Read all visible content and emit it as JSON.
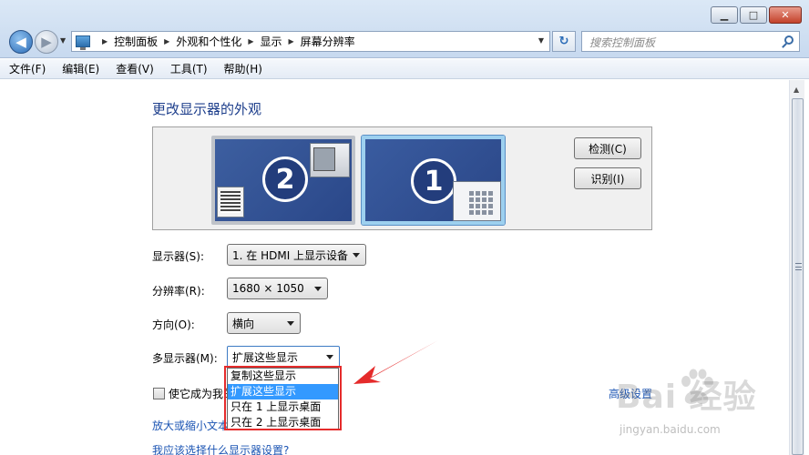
{
  "window": {
    "buttons": {
      "minimize": "▁",
      "maximize": "□",
      "close": "✕"
    }
  },
  "nav": {
    "back_icon": "◀",
    "forward_icon": "▶",
    "breadcrumbs": [
      "控制面板",
      "外观和个性化",
      "显示",
      "屏幕分辨率"
    ],
    "search_placeholder": "搜索控制面板",
    "refresh_icon": "↻"
  },
  "menu": [
    "文件(F)",
    "编辑(E)",
    "查看(V)",
    "工具(T)",
    "帮助(H)"
  ],
  "main": {
    "title": "更改显示器的外观",
    "monitors": [
      {
        "number": "2",
        "selected": false
      },
      {
        "number": "1",
        "selected": true
      }
    ],
    "detect_label": "检测(C)",
    "identify_label": "识别(I)",
    "display_label": "显示器(S):",
    "display_value": "1. 在 HDMI 上显示设备",
    "resolution_label": "分辨率(R):",
    "resolution_value": "1680 × 1050",
    "orientation_label": "方向(O):",
    "orientation_value": "横向",
    "multi_label": "多显示器(M):",
    "multi_value": "扩展这些显示",
    "multi_options": [
      "复制这些显示",
      "扩展这些显示",
      "只在 1 上显示桌面",
      "只在 2 上显示桌面"
    ],
    "multi_selected_index": 1,
    "primary_checkbox_label": "使它成为我的",
    "advanced_link": "高级设置",
    "zoom_link": "放大或缩小文本",
    "what_link": "我应该选择什么显示器设置?"
  },
  "watermark": {
    "logo": "Bai 经验",
    "url": "jingyan.baidu.com"
  },
  "colors": {
    "accent": "#1e3f8c",
    "link": "#1b54b3",
    "highlight": "#3399ff",
    "annotation_red": "#e52b2b"
  }
}
